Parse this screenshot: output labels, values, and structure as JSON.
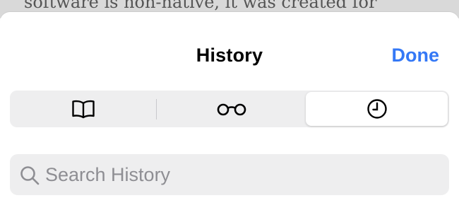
{
  "background": {
    "text": "software is non-native, it was created for"
  },
  "header": {
    "title": "History",
    "done_label": "Done"
  },
  "segments": [
    {
      "icon": "bookmarks-book-icon",
      "selected": false
    },
    {
      "icon": "reading-list-glasses-icon",
      "selected": false
    },
    {
      "icon": "history-clock-icon",
      "selected": true
    }
  ],
  "search": {
    "placeholder": "Search History",
    "value": ""
  },
  "colors": {
    "accent": "#3478f6",
    "segment_bg": "#eeeeef",
    "placeholder": "#8e8e93"
  }
}
